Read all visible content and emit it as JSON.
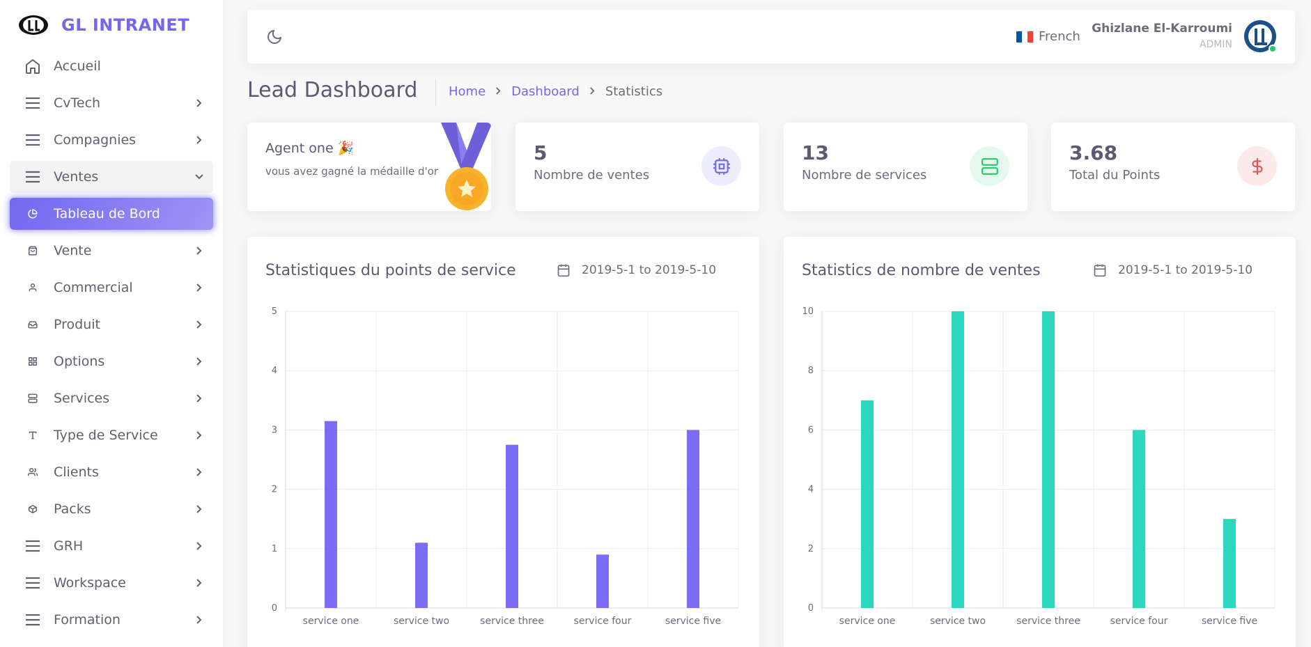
{
  "brand": {
    "name": "GL INTRANET"
  },
  "sidebar": {
    "items": [
      {
        "label": "Accueil",
        "icon": "home-icon"
      },
      {
        "label": "CvTech",
        "icon": "menu-icon"
      },
      {
        "label": "Compagnies",
        "icon": "menu-icon"
      },
      {
        "label": "Ventes",
        "icon": "menu-icon"
      },
      {
        "label": "Tableau de Bord",
        "icon": "pie-chart-icon"
      },
      {
        "label": "Vente",
        "icon": "shopping-bag-icon"
      },
      {
        "label": "Commercial",
        "icon": "user-icon"
      },
      {
        "label": "Produit",
        "icon": "inbox-icon"
      },
      {
        "label": "Options",
        "icon": "grid-icon"
      },
      {
        "label": "Services",
        "icon": "server-icon"
      },
      {
        "label": "Type de Service",
        "icon": "type-icon"
      },
      {
        "label": "Clients",
        "icon": "users-icon"
      },
      {
        "label": "Packs",
        "icon": "package-icon"
      },
      {
        "label": "GRH",
        "icon": "menu-icon"
      },
      {
        "label": "Workspace",
        "icon": "menu-icon"
      },
      {
        "label": "Formation",
        "icon": "menu-icon"
      }
    ]
  },
  "header": {
    "language": "French",
    "user_name": "Ghizlane El-Karroumi",
    "user_role": "ADMIN"
  },
  "page": {
    "title": "Lead Dashboard",
    "breadcrumb": {
      "home": "Home",
      "dashboard": "Dashboard",
      "current": "Statistics"
    }
  },
  "medal_card": {
    "agent": "Agent one 🎉",
    "subtitle": "vous avez gagné la médaille d'or"
  },
  "stats": [
    {
      "value": "5",
      "label": "Nombre de ventes",
      "icon": "cpu-icon",
      "color": "#7367f0"
    },
    {
      "value": "13",
      "label": "Nombre de services",
      "icon": "server-icon",
      "color": "#28c76f"
    },
    {
      "value": "3.68",
      "label": "Total du Points",
      "icon": "dollar-icon",
      "color": "#ea5455"
    }
  ],
  "chart_data": [
    {
      "type": "bar",
      "title": "Statistiques du points de service",
      "date_range": "2019-5-1 to 2019-5-10",
      "categories": [
        "service one",
        "service two",
        "service three",
        "service four",
        "service five"
      ],
      "values": [
        3.15,
        1.1,
        2.75,
        0.9,
        3.0
      ],
      "ylim": [
        0,
        5
      ],
      "yticks": [
        0,
        1,
        2,
        3,
        4,
        5
      ],
      "color": "#7b6cf6",
      "grid": true
    },
    {
      "type": "bar",
      "title": "Statistics de nombre de ventes",
      "date_range": "2019-5-1 to 2019-5-10",
      "categories": [
        "service one",
        "service two",
        "service three",
        "service four",
        "service five"
      ],
      "values": [
        7,
        10,
        10,
        6,
        3
      ],
      "ylim": [
        0,
        10
      ],
      "yticks": [
        0,
        2,
        4,
        6,
        8,
        10
      ],
      "color": "#2dd6bf",
      "grid": true
    }
  ]
}
